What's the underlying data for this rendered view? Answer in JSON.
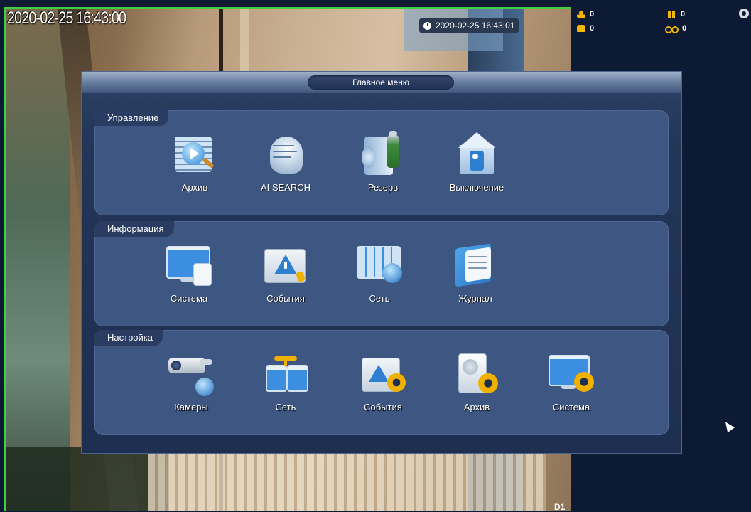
{
  "osd": {
    "datetime": "2020-02-25 16:43:00",
    "chip_datetime": "2020-02-25 16:43:01",
    "channel": "D1"
  },
  "stats": {
    "person": "0",
    "pedestrians": "0",
    "car": "0",
    "bike": "0"
  },
  "menu": {
    "title": "Главное меню",
    "groups": [
      {
        "title": "Управление",
        "items": [
          {
            "label": "Архив",
            "icon": "playback-film-icon"
          },
          {
            "label": "AI SEARCH",
            "icon": "ai-head-icon"
          },
          {
            "label": "Резерв",
            "icon": "backup-usb-icon"
          },
          {
            "label": "Выключение",
            "icon": "shutdown-exit-icon"
          }
        ]
      },
      {
        "title": "Информация",
        "items": [
          {
            "label": "Система",
            "icon": "system-monitor-icon"
          },
          {
            "label": "События",
            "icon": "event-warning-icon"
          },
          {
            "label": "Сеть",
            "icon": "network-globe-icon"
          },
          {
            "label": "Журнал",
            "icon": "log-book-icon"
          }
        ]
      },
      {
        "title": "Настройка",
        "items": [
          {
            "label": "Камеры",
            "icon": "camera-icon"
          },
          {
            "label": "Сеть",
            "icon": "network-settings-icon"
          },
          {
            "label": "События",
            "icon": "event-settings-icon"
          },
          {
            "label": "Архив",
            "icon": "storage-settings-icon"
          },
          {
            "label": "Система",
            "icon": "system-settings-icon"
          }
        ]
      }
    ]
  },
  "colors": {
    "accent_green": "#3fcf3f",
    "stat_yellow": "#f5b800",
    "panel_bg": "#3e5682"
  }
}
